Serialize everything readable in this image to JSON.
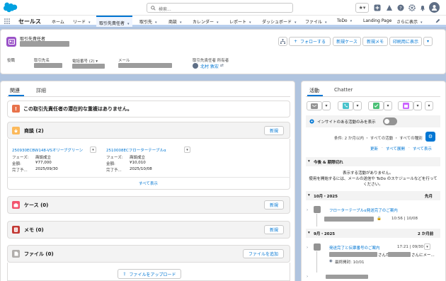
{
  "search": {
    "placeholder": "検索..."
  },
  "nav": {
    "app_name": "セールス",
    "items": [
      "ホーム",
      "リード",
      "取引先責任者",
      "取引先",
      "商談",
      "カレンダー",
      "レポート",
      "ダッシュボード",
      "ファイル",
      "ToDo",
      "Landing Page",
      "さらに表示"
    ]
  },
  "record": {
    "type_label": "取引先責任者",
    "fields": {
      "title_label": "役職",
      "account_label": "取引先名",
      "phone_label": "電話番号 (2)",
      "email_label": "メール",
      "owner_label": "取引先責任者 所有者",
      "owner_value": "北村 敦宏"
    },
    "buttons": {
      "follow": "フォローする",
      "new_case": "新規ケース",
      "new_memo": "新規メモ",
      "print": "印刷用に表示"
    }
  },
  "left_tabs": {
    "related": "関連",
    "detail": "詳細"
  },
  "duplicate_notice": "この取引先責任者の潜在的な重複はありません。",
  "opportunities": {
    "title": "商談 (2)",
    "new_button": "新規",
    "records": [
      {
        "name": "250930ECBW148-VSオリーブグリーン",
        "phase_label": "フェーズ:",
        "phase": "商談成立",
        "amount_label": "金額:",
        "amount": "¥77,000",
        "close_label": "完了予...",
        "close": "2025/09/30"
      },
      {
        "name": "2510008ECフローターテーブルα",
        "phase_label": "フェーズ:",
        "phase": "商談成立",
        "amount_label": "金額:",
        "amount": "¥10,010",
        "close_label": "完了予...",
        "close": "2025/10/08"
      }
    ],
    "view_all": "すべて表示"
  },
  "cases": {
    "title": "ケース (0)",
    "new_button": "新規"
  },
  "memos": {
    "title": "メモ (0)",
    "new_button": "新規"
  },
  "files": {
    "title": "ファイル (0)",
    "add_button": "ファイルを追加",
    "upload_button": "ファイルをアップロード"
  },
  "right_tabs": {
    "activity": "活動",
    "chatter": "Chatter"
  },
  "activity": {
    "insights_label": "インサイトのある活動のみを表示",
    "filter_text": "条件: 2 か月以内 ・ すべての活動 ・ すべての種別",
    "links": [
      "更新",
      "すべて展開",
      "すべて表示"
    ],
    "upcoming_title": "今後 & 期限切れ",
    "no_activity": "表示する活動がありません。",
    "help_text": "使用を開始するには、メールの送信や ToDo のスケジュールなどを行ってください。",
    "months": [
      {
        "label": "10月・2025",
        "right": "先月",
        "item_title": "フローターテーブルα発送完了のご案内",
        "time": "10:56 | 10/08"
      },
      {
        "label": "9月・2025",
        "right": "2 か月前",
        "item_title": "発送完了と伝票番号のご案内",
        "time": "17:21 | 09/30",
        "snippet": "さんか",
        "snippet2": "さんにメー...",
        "last_opened": "最終開封: 10/01"
      }
    ]
  }
}
